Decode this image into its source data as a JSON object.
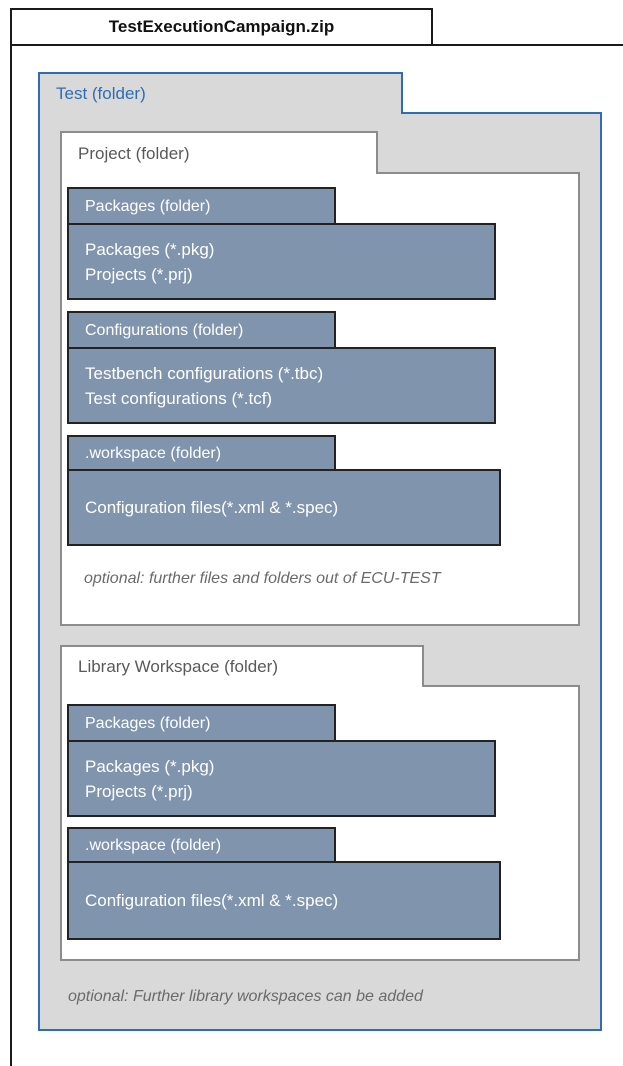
{
  "zip": {
    "title": "TestExecutionCampaign.zip"
  },
  "test": {
    "label": "Test (folder)"
  },
  "project": {
    "label": "Project (folder)",
    "packages": {
      "label": "Packages (folder)",
      "lines": [
        "Packages (*.pkg)",
        "Projects (*.prj)"
      ]
    },
    "configurations": {
      "label": "Configurations (folder)",
      "lines": [
        "Testbench configurations (*.tbc)",
        "Test configurations (*.tcf)"
      ]
    },
    "workspace": {
      "label": ".workspace (folder)",
      "lines": [
        "Configuration files(*.xml & *.spec)"
      ]
    },
    "note": "optional: further files and folders out of ECU-TEST"
  },
  "library": {
    "label": "Library Workspace (folder)",
    "packages": {
      "label": "Packages (folder)",
      "lines": [
        "Packages (*.pkg)",
        "Projects (*.prj)"
      ]
    },
    "workspace": {
      "label": ".workspace (folder)",
      "lines": [
        "Configuration files(*.xml & *.spec)"
      ]
    }
  },
  "footer_note": "optional: Further library workspaces can be added",
  "colors": {
    "root_border": "#1a1a1a",
    "test_blue": "#2e6db4",
    "folder_gray": "#d9d9d9",
    "dark_folder": "#8094ae"
  }
}
